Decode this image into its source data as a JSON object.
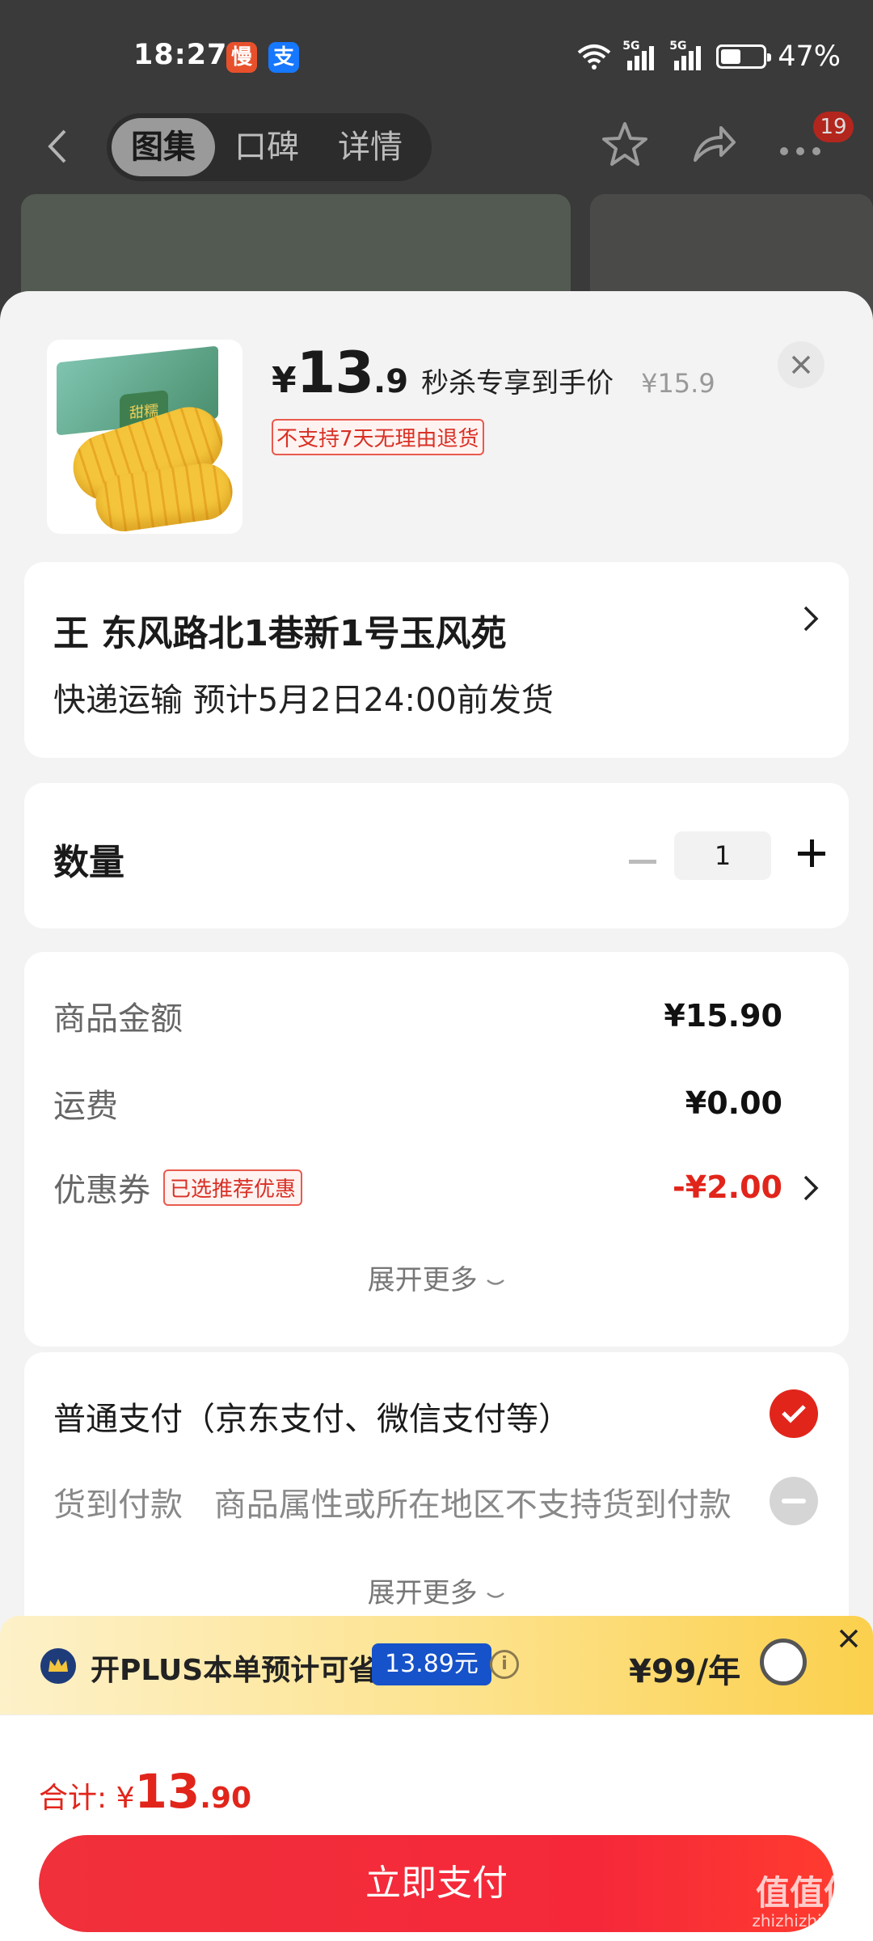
{
  "status_bar": {
    "time": "18:27",
    "app_badge_1": "慢",
    "app_badge_2": "支",
    "signal_1_tag": "5G",
    "signal_2_tag": "5G",
    "battery_level": 0.47,
    "battery_percent": "47%"
  },
  "nav": {
    "tabs": [
      "图集",
      "口碑",
      "详情"
    ],
    "active_tab": "图集",
    "notification_count": "19"
  },
  "product": {
    "thumb_label": "甜糯",
    "currency": "¥",
    "price_int": "13",
    "price_dec": ".9",
    "price_desc": "秒杀专享到手价",
    "original_price": "¥15.9",
    "policy_tag": "不支持7天无理由退货"
  },
  "address": {
    "line": "王  东风路北1巷新1号玉风苑",
    "shipping": "快递运输 预计5月2日24:00前发货"
  },
  "quantity": {
    "label": "数量",
    "value": "1"
  },
  "amounts": {
    "goods_label": "商品金额",
    "goods_value": "¥15.90",
    "shipping_label": "运费",
    "shipping_value": "¥0.00",
    "coupon_label": "优惠券",
    "coupon_tag": "已选推荐优惠",
    "coupon_value": "-¥2.00",
    "expand_label": "展开更多"
  },
  "payment": {
    "normal_label": "普通支付（京东支付、微信支付等）",
    "cod_label": "货到付款",
    "cod_note": "商品属性或所在地区不支持货到付款",
    "expand_label": "展开更多"
  },
  "plus_banner": {
    "text": "开PLUS本单预计可省",
    "save_badge": "13.89元",
    "price": "¥99/年"
  },
  "bottom": {
    "total_label": "合计:",
    "total_currency": "¥",
    "total_int": "13",
    "total_dec": ".90",
    "pay_button": "立即支付"
  },
  "watermark": {
    "text_big": "值值值",
    "text_small": "zhizhizhi.com"
  },
  "colors": {
    "accent_red": "#e1251b",
    "plus_blue": "#1652c9",
    "plus_gold": "#fde28b"
  }
}
